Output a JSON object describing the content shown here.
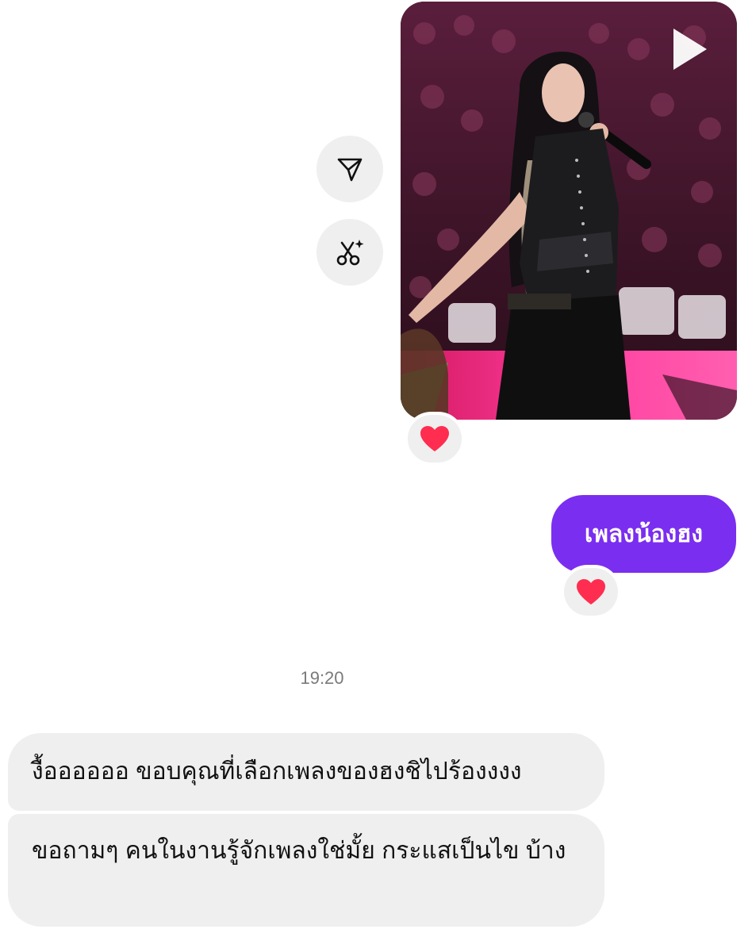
{
  "actions": {
    "share_icon": "paper-plane-icon",
    "remix_icon": "scissors-sparkle-icon"
  },
  "media_message": {
    "type": "video",
    "play_icon": "play-icon",
    "reaction": "❤️"
  },
  "outgoing_message": {
    "text": "เพลงน้องฮง",
    "reaction": "❤️",
    "bubble_color": "#7a2ef0"
  },
  "timestamp": "19:20",
  "incoming_messages": [
    {
      "text": "งื้ออออออ ขอบคุณที่เลือกเพลงของฮงชิไปร้องงงง"
    },
    {
      "text": "ขอถามๆ คนในงานรู้จักเพลงใช่มั้ย กระแสเป็นไข บ้าง"
    }
  ],
  "colors": {
    "incoming_bubble": "#efefef",
    "heart": "#ff2d4f",
    "timestamp": "#7a7a7a"
  }
}
